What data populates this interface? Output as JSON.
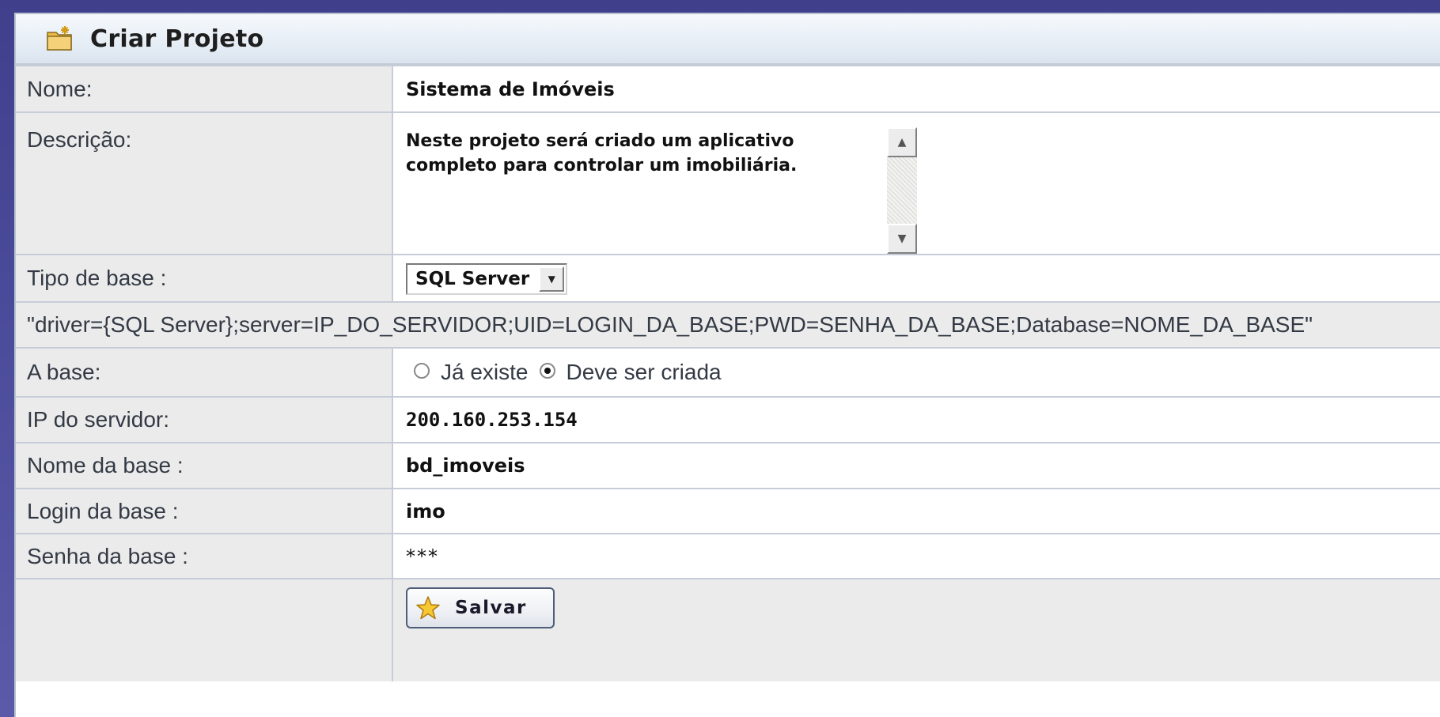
{
  "panel": {
    "title": "Criar Projeto",
    "title_icon": "folder-new-icon"
  },
  "form": {
    "nome": {
      "label": "Nome:",
      "value": "Sistema de Imóveis"
    },
    "descricao": {
      "label": "Descrição:",
      "line1": "Neste projeto será criado um aplicativo",
      "line2": "completo para controlar um imobiliária."
    },
    "tipo_base": {
      "label": "Tipo de base :",
      "selected": "SQL Server"
    },
    "connection_string": "\"driver={SQL Server};server=IP_DO_SERVIDOR;UID=LOGIN_DA_BASE;PWD=SENHA_DA_BASE;Database=NOME_DA_BASE\"",
    "a_base": {
      "label": "A base:",
      "options": [
        "Já existe",
        "Deve ser criada"
      ],
      "selected": "Deve ser criada"
    },
    "ip_servidor": {
      "label": "IP do servidor:",
      "value": "200.160.253.154"
    },
    "nome_base": {
      "label": "Nome da base :",
      "value": "bd_imoveis"
    },
    "login_base": {
      "label": "Login da base :",
      "value": "imo"
    },
    "senha_base": {
      "label": "Senha da base :",
      "value": "***"
    },
    "save_button": {
      "label": "Salvar",
      "icon": "star-icon"
    }
  },
  "colors": {
    "background": "#4a4a9a",
    "label_bg": "#ebebeb",
    "border": "#c7cdd8"
  }
}
